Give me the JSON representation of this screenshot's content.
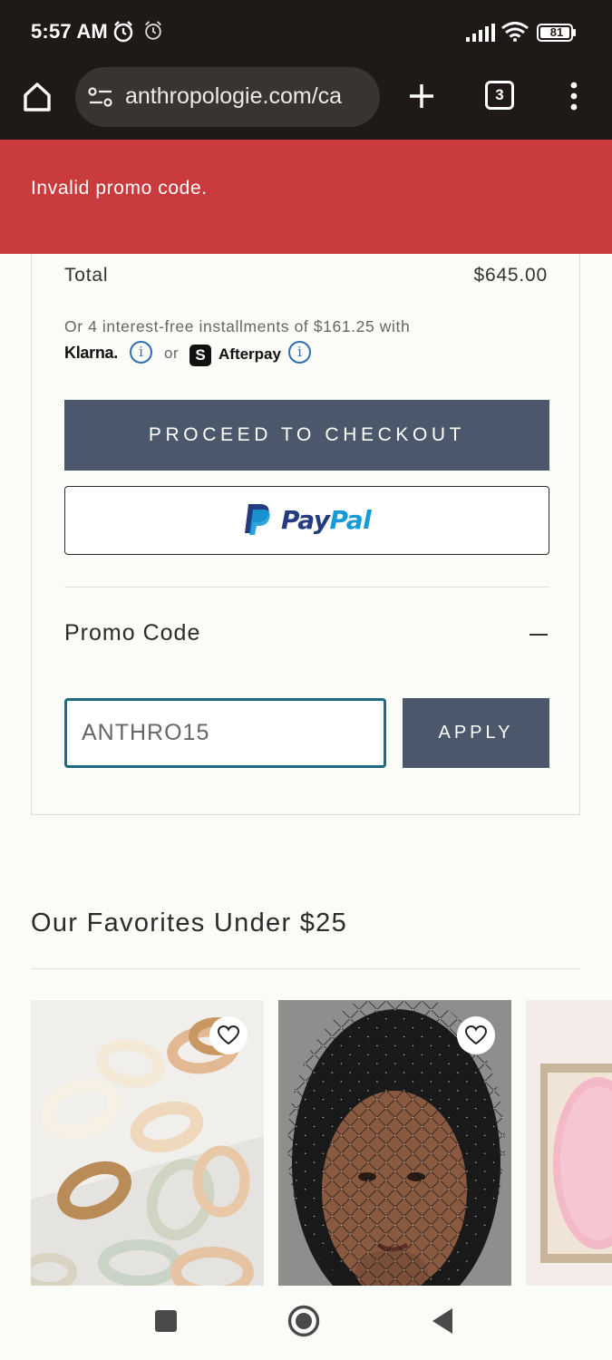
{
  "status_bar": {
    "time": "5:57 AM",
    "battery": "81",
    "icons": [
      "alarm-icon",
      "alarm-outline-icon",
      "signal-icon",
      "wifi-icon",
      "battery-icon"
    ]
  },
  "browser": {
    "url": "anthropologie.com/ca",
    "tab_count": "3",
    "icons": [
      "home-icon",
      "site-settings-icon",
      "new-tab-icon",
      "tabs-icon",
      "more-menu-icon"
    ]
  },
  "banner": {
    "message": "Invalid promo code.",
    "color": "#c93b3d"
  },
  "summary": {
    "total_label": "Total",
    "total_value": "$645.00",
    "installments_text": "Or 4 interest-free installments of $161.25 with",
    "klarna_label": "Klarna.",
    "or_text": "or",
    "afterpay_label": "Afterpay",
    "checkout_label": "PROCEED TO CHECKOUT",
    "paypal_pay": "Pay",
    "paypal_pal": "Pal",
    "accent_color": "#4b586b"
  },
  "promo": {
    "title": "Promo Code",
    "input_value": "ANTHRO15",
    "apply_label": "APPLY"
  },
  "favorites": {
    "title": "Our Favorites Under $25",
    "products": [
      {
        "image": "fabric-hair-ties-photo"
      },
      {
        "image": "crystal-net-hair-veil-photo"
      },
      {
        "image": "pink-gel-face-mask-photo"
      }
    ]
  },
  "nav": {
    "icons": [
      "recents-square-icon",
      "home-circle-icon",
      "back-triangle-icon"
    ]
  }
}
